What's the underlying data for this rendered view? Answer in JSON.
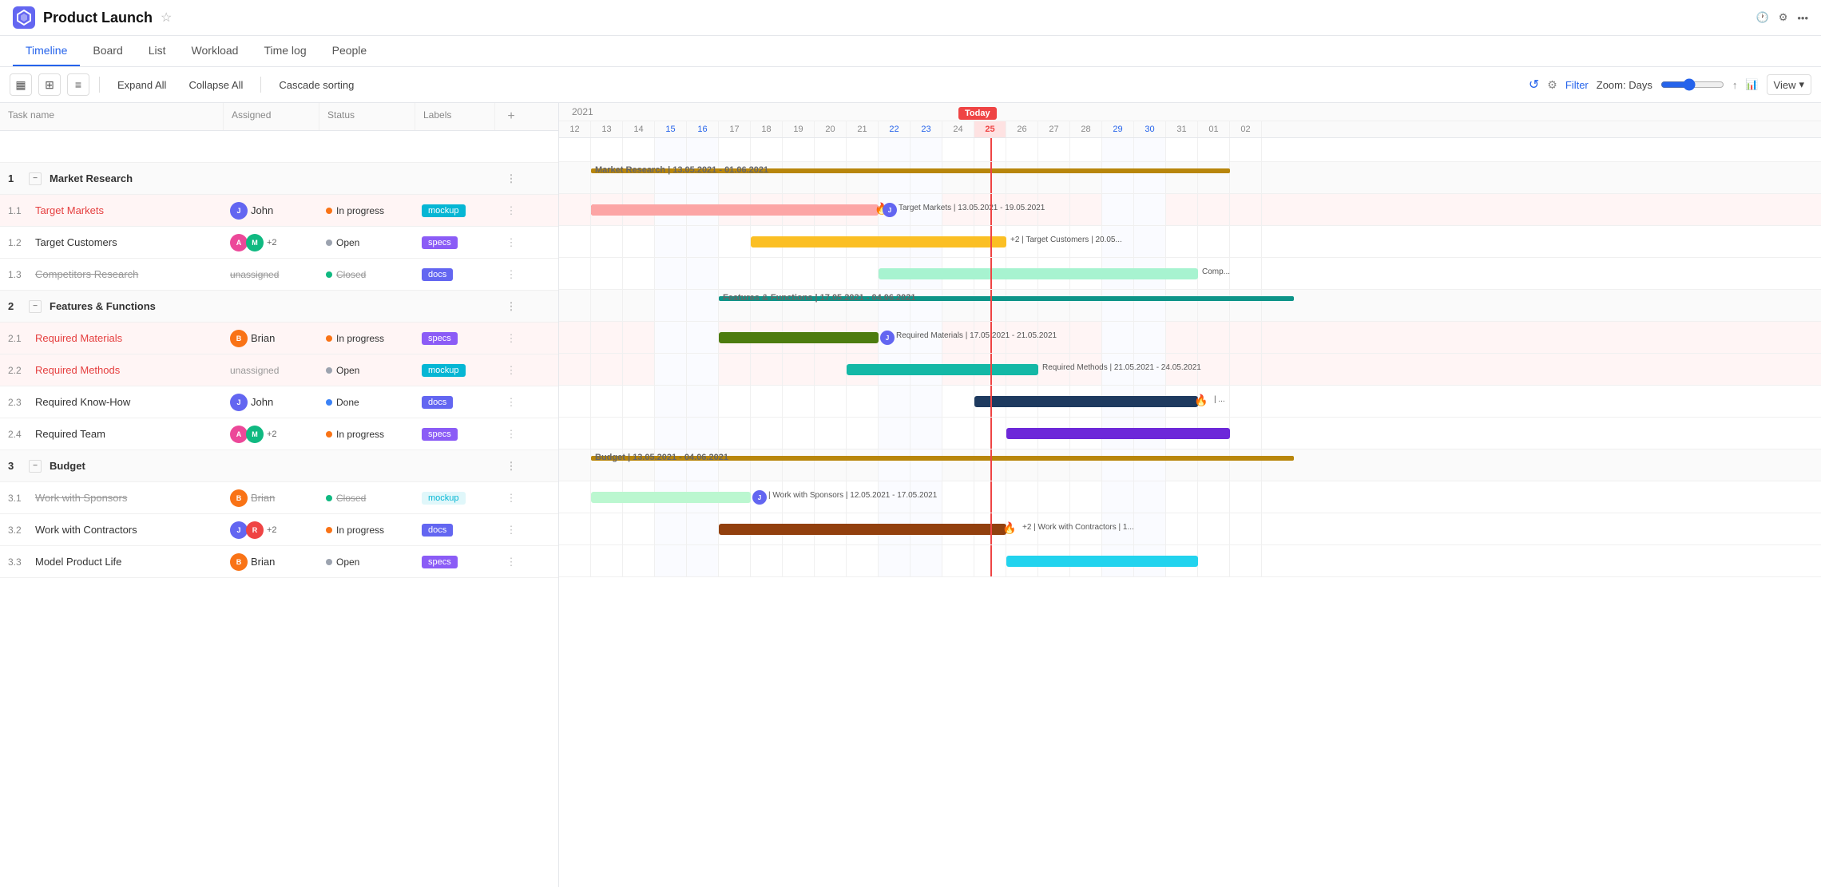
{
  "app": {
    "title": "Product Launch",
    "logo_color": "#6366f1"
  },
  "nav": {
    "tabs": [
      {
        "id": "timeline",
        "label": "Timeline",
        "active": true
      },
      {
        "id": "board",
        "label": "Board",
        "active": false
      },
      {
        "id": "list",
        "label": "List",
        "active": false
      },
      {
        "id": "workload",
        "label": "Workload",
        "active": false
      },
      {
        "id": "timelog",
        "label": "Time log",
        "active": false
      },
      {
        "id": "people",
        "label": "People",
        "active": false
      }
    ]
  },
  "toolbar": {
    "expand_all": "Expand All",
    "collapse_all": "Collapse All",
    "cascade_sorting": "Cascade sorting",
    "filter_label": "Filter",
    "zoom_label": "Zoom: Days",
    "view_label": "View"
  },
  "table": {
    "headers": [
      "Task name",
      "Assigned",
      "Status",
      "Labels",
      "+"
    ],
    "rows": [
      {
        "id": "1",
        "type": "group",
        "num": "1",
        "name": "Market Research",
        "assigned": "",
        "status": "",
        "label": ""
      },
      {
        "id": "1.1",
        "type": "task",
        "num": "1.1",
        "name": "Target Markets",
        "style": "red",
        "assigned": "John",
        "status": "In progress",
        "status_type": "in-progress",
        "label": "mockup",
        "label_type": "mockup"
      },
      {
        "id": "1.2",
        "type": "task",
        "num": "1.2",
        "name": "Target Customers",
        "style": "normal",
        "assigned": "+2",
        "avatar1": "anna",
        "avatar2": "mike",
        "status": "Open",
        "status_type": "open",
        "label": "specs",
        "label_type": "specs"
      },
      {
        "id": "1.3",
        "type": "task",
        "num": "1.3",
        "name": "Competitors Research",
        "style": "strikethrough",
        "assigned": "unassigned",
        "status": "Closed",
        "status_type": "closed",
        "label": "docs",
        "label_type": "docs"
      },
      {
        "id": "2",
        "type": "group",
        "num": "2",
        "name": "Features & Functions",
        "assigned": "",
        "status": "",
        "label": ""
      },
      {
        "id": "2.1",
        "type": "task",
        "num": "2.1",
        "name": "Required Materials",
        "style": "red",
        "assigned": "Brian",
        "status": "In progress",
        "status_type": "in-progress",
        "label": "specs",
        "label_type": "specs"
      },
      {
        "id": "2.2",
        "type": "task",
        "num": "2.2",
        "name": "Required Methods",
        "style": "red",
        "assigned": "unassigned",
        "status": "Open",
        "status_type": "open",
        "label": "mockup",
        "label_type": "mockup"
      },
      {
        "id": "2.3",
        "type": "task",
        "num": "2.3",
        "name": "Required Know-How",
        "style": "normal",
        "assigned": "John",
        "status": "Done",
        "status_type": "done",
        "label": "docs",
        "label_type": "docs"
      },
      {
        "id": "2.4",
        "type": "task",
        "num": "2.4",
        "name": "Required Team",
        "style": "normal",
        "assigned": "+2",
        "avatar1": "anna",
        "avatar2": "mike",
        "status": "In progress",
        "status_type": "in-progress",
        "label": "specs",
        "label_type": "specs"
      },
      {
        "id": "3",
        "type": "group",
        "num": "3",
        "name": "Budget",
        "assigned": "",
        "status": "",
        "label": ""
      },
      {
        "id": "3.1",
        "type": "task",
        "num": "3.1",
        "name": "Work with Sponsors",
        "style": "strikethrough",
        "assigned": "Brian",
        "status": "Closed",
        "status_type": "closed",
        "label": "mockup",
        "label_type": "mockup-light"
      },
      {
        "id": "3.2",
        "type": "task",
        "num": "3.2",
        "name": "Work with Contractors",
        "style": "normal",
        "assigned": "+2",
        "avatar1": "john",
        "avatar2": "red2",
        "status": "In progress",
        "status_type": "in-progress",
        "label": "docs",
        "label_type": "docs"
      },
      {
        "id": "3.3",
        "type": "task",
        "num": "3.3",
        "name": "Model Product Life",
        "style": "normal",
        "assigned": "Brian",
        "status": "Open",
        "status_type": "open",
        "label": "specs",
        "label_type": "specs"
      }
    ]
  },
  "gantt": {
    "year": "2021",
    "days": [
      12,
      13,
      14,
      15,
      16,
      17,
      18,
      19,
      20,
      21,
      22,
      23,
      24,
      25,
      26,
      27,
      28,
      29,
      30,
      31,
      "01",
      "02"
    ],
    "weekend_days": [
      15,
      16,
      22,
      23,
      29,
      30
    ],
    "today_day": 25,
    "today_label": "Today"
  }
}
